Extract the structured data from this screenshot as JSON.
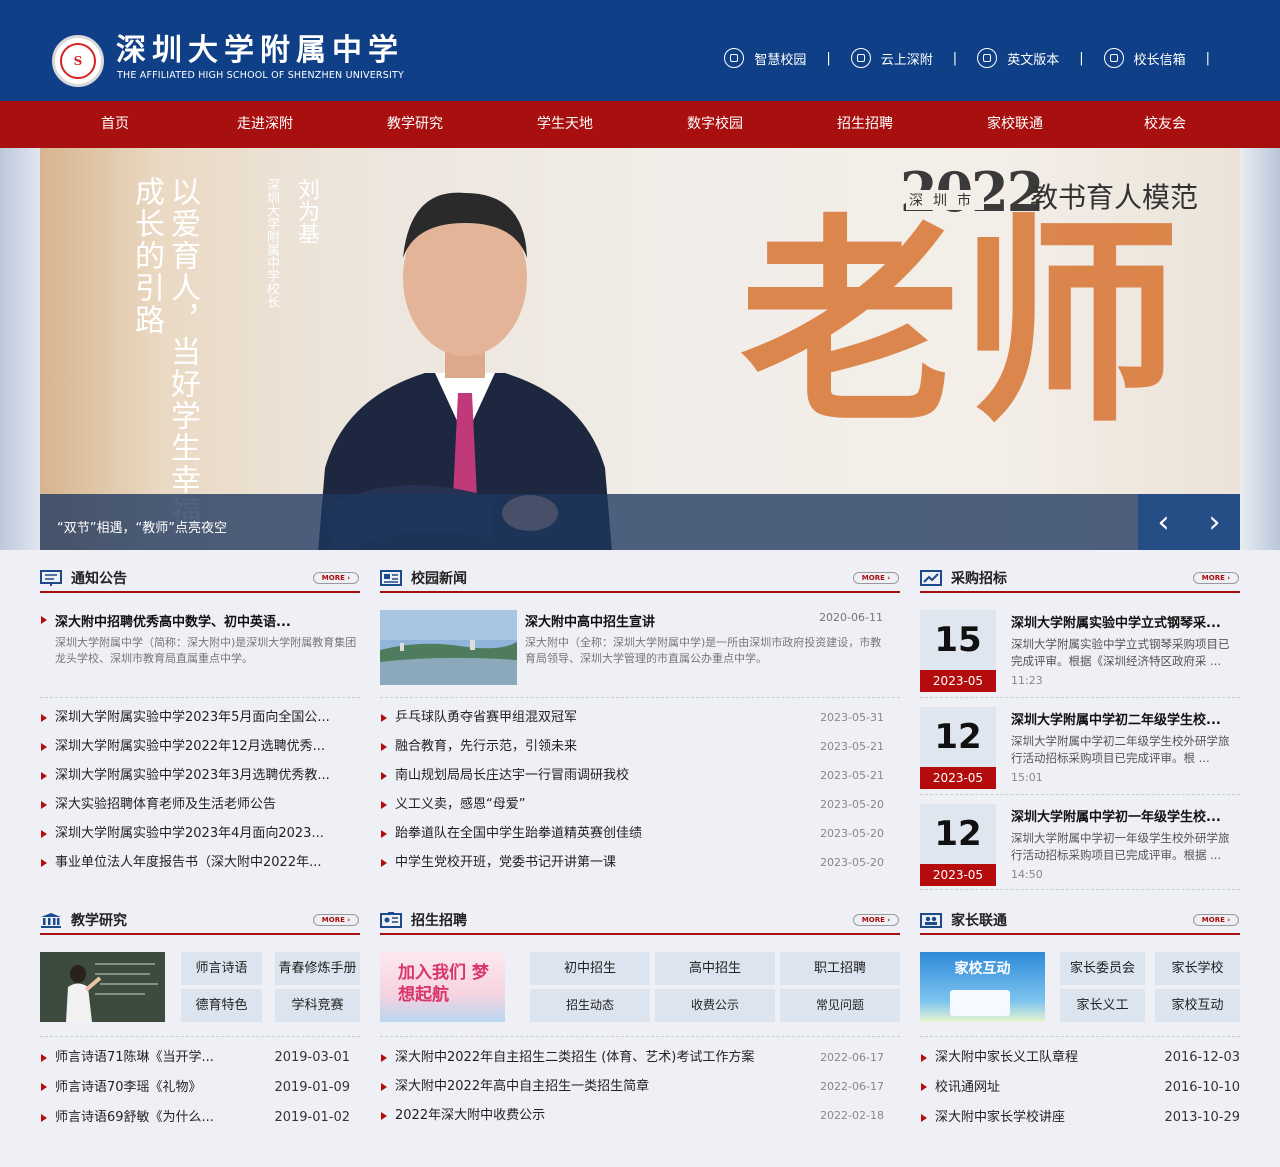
{
  "header": {
    "title": "深圳大学附属中学",
    "subtitle": "THE AFFILIATED HIGH SCHOOL OF SHENZHEN UNIVERSITY",
    "links": [
      "智慧校园",
      "云上深附",
      "英文版本",
      "校长信箱"
    ],
    "separator": "|"
  },
  "nav": [
    "首页",
    "走进深附",
    "教学研究",
    "学生天地",
    "数字校园",
    "招生招聘",
    "家校联通",
    "校友会"
  ],
  "banner": {
    "slogan": "以爱育人，当好学生幸福成长的引路",
    "name": "刘为基",
    "role": "深圳大学附属中学校长",
    "year": "2022",
    "city": "深圳市",
    "tag": "教书育人模范",
    "big": "老师",
    "caption": "“双节”相遇，“教师”点亮夜空",
    "prev": "‹",
    "next": "›"
  },
  "more_label": "MORE ›",
  "notice": {
    "title": "通知公告",
    "featured_title": "深大附中招聘优秀高中数学、初中英语...",
    "featured_desc": "深圳大学附属中学（简称：深大附中)是深圳大学附属教育集团龙头学校、深圳市教育局直属重点中学。",
    "items": [
      "深圳大学附属实验中学2023年5月面向全国公...",
      "深圳大学附属实验中学2022年12月选聘优秀...",
      "深圳大学附属实验中学2023年3月选聘优秀教...",
      "深大实验招聘体育老师及生活老师公告",
      "深圳大学附属实验中学2023年4月面向2023...",
      "事业单位法人年度报告书（深大附中2022年..."
    ]
  },
  "news": {
    "title": "校园新闻",
    "featured_title": "深大附中高中招生宣讲",
    "featured_date": "2020-06-11",
    "featured_desc": "深大附中（全称：深圳大学附属中学)是一所由深圳市政府投资建设，市教育局领导、深圳大学管理的市直属公办重点中学。",
    "items": [
      {
        "t": "乒乓球队勇夺省赛甲组混双冠军",
        "d": "2023-05-31"
      },
      {
        "t": "融合教育，先行示范，引领未来",
        "d": "2023-05-21"
      },
      {
        "t": "南山规划局局长庄达宇一行冒雨调研我校",
        "d": "2023-05-21"
      },
      {
        "t": "义工义卖，感恩“母爱”",
        "d": "2023-05-20"
      },
      {
        "t": "跆拳道队在全国中学生跆拳道精英赛创佳绩",
        "d": "2023-05-20"
      },
      {
        "t": "中学生党校开班，党委书记开讲第一课",
        "d": "2023-05-20"
      }
    ]
  },
  "procurement": {
    "title": "采购招标",
    "items": [
      {
        "day": "15",
        "ym": "2023-05",
        "t": "深圳大学附属实验中学立式钢琴采...",
        "desc": "深圳大学附属实验中学立式钢琴采购项目已完成评审。根据《深圳经济特区政府采 ...",
        "time": "11:23"
      },
      {
        "day": "12",
        "ym": "2023-05",
        "t": "深圳大学附属中学初二年级学生校...",
        "desc": "深圳大学附属中学初二年级学生校外研学旅行活动招标采购项目已完成评审。根 ...",
        "time": "15:01"
      },
      {
        "day": "12",
        "ym": "2023-05",
        "t": "深圳大学附属中学初一年级学生校...",
        "desc": "深圳大学附属中学初一年级学生校外研学旅行活动招标采购项目已完成评审。根据 ...",
        "time": "14:50"
      }
    ]
  },
  "teaching": {
    "title": "教学研究",
    "buttons": [
      "师言诗语",
      "青春修炼手册",
      "德育特色",
      "学科竞赛"
    ],
    "items": [
      {
        "t": "师言诗语71陈琳《当开学...",
        "d": "2019-03-01"
      },
      {
        "t": "师言诗语70李瑶《礼物》",
        "d": "2019-01-09"
      },
      {
        "t": "师言诗语69舒敏《为什么...",
        "d": "2019-01-02"
      }
    ]
  },
  "admission": {
    "title": "招生招聘",
    "image_text": "加入我们 梦想起航",
    "buttons": [
      "初中招生",
      "高中招生",
      "职工招聘",
      "招生动态",
      "收费公示",
      "常见问题"
    ],
    "items": [
      {
        "t": "深大附中2022年自主招生二类招生 (体育、艺术)考试工作方案",
        "d": "2022-06-17"
      },
      {
        "t": "深大附中2022年高中自主招生一类招生简章",
        "d": "2022-06-17"
      },
      {
        "t": "2022年深大附中收费公示",
        "d": "2022-02-18"
      }
    ]
  },
  "parents": {
    "title": "家长联通",
    "image_text": "家校互动",
    "buttons": [
      "家长委员会",
      "家长学校",
      "家长义工",
      "家校互动"
    ],
    "items": [
      {
        "t": "深大附中家长义工队章程",
        "d": "2016-12-03"
      },
      {
        "t": "校讯通网址",
        "d": "2016-10-10"
      },
      {
        "t": "深大附中家长学校讲座",
        "d": "2013-10-29"
      }
    ]
  }
}
